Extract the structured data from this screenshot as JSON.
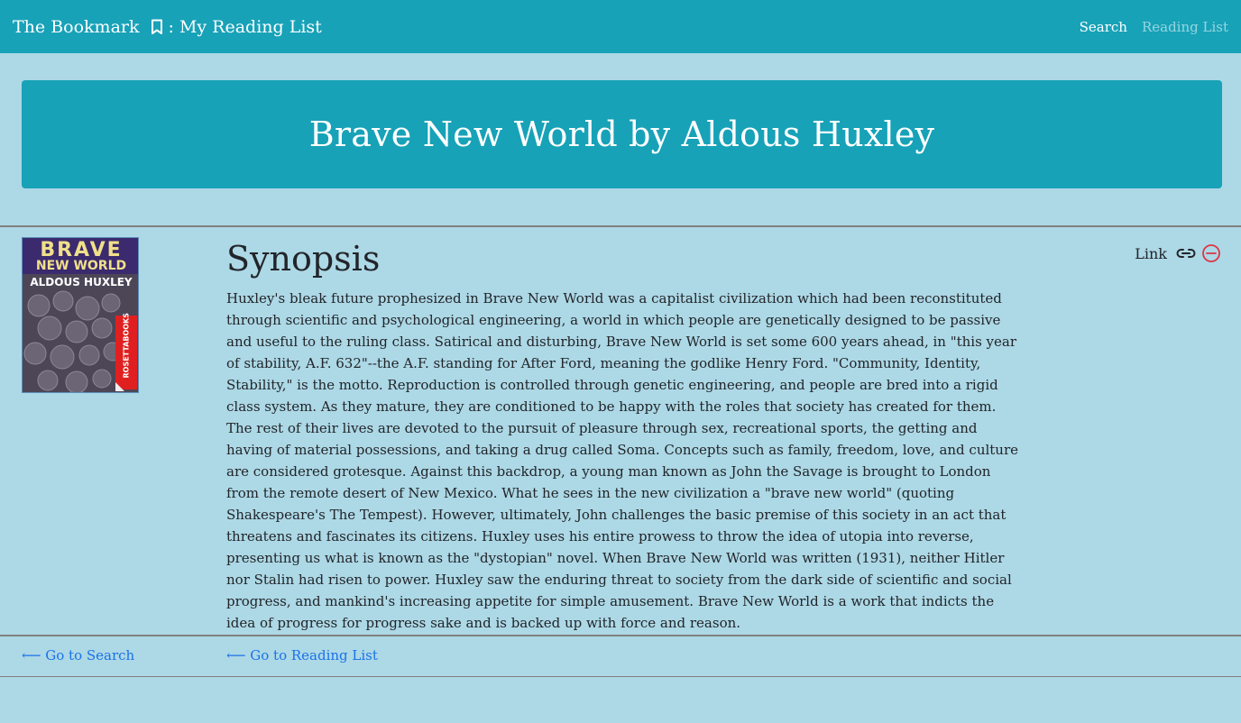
{
  "navbar": {
    "brand_prefix": "The Bookmark",
    "brand_suffix": ": My Reading List",
    "brand_icon": "bookmark-icon",
    "links": [
      {
        "label": "Search",
        "active": true
      },
      {
        "label": "Reading List",
        "active": false
      }
    ]
  },
  "header": {
    "title": "Brave New World by Aldous Huxley"
  },
  "book": {
    "cover": {
      "title_line1": "BRAVE",
      "title_line2": "NEW WORLD",
      "author": "ALDOUS HUXLEY",
      "publisher": "ROSETTABOOKS"
    },
    "synopsis_heading": "Synopsis",
    "synopsis_text": "Huxley's bleak future prophesized in Brave New World was a capitalist civilization which had been reconstituted through scientific and psychological engineering, a world in which people are genetically designed to be passive and useful to the ruling class. Satirical and disturbing, Brave New World is set some 600 years ahead, in \"this year of stability, A.F. 632\"--the A.F. standing for After Ford, meaning the godlike Henry Ford. \"Community, Identity, Stability,\" is the motto. Reproduction is controlled through genetic engineering, and people are bred into a rigid class system. As they mature, they are conditioned to be happy with the roles that society has created for them. The rest of their lives are devoted to the pursuit of pleasure through sex, recreational sports, the getting and having of material possessions, and taking a drug called Soma. Concepts such as family, freedom, love, and culture are considered grotesque. Against this backdrop, a young man known as John the Savage is brought to London from the remote desert of New Mexico. What he sees in the new civilization a \"brave new world\" (quoting Shakespeare's The Tempest). However, ultimately, John challenges the basic premise of this society in an act that threatens and fascinates its citizens. Huxley uses his entire prowess to throw the idea of utopia into reverse, presenting us what is known as the \"dystopian\" novel. When Brave New World was written (1931), neither Hitler nor Stalin had risen to power. Huxley saw the enduring threat to society from the dark side of scientific and social progress, and mankind's increasing appetite for simple amusement. Brave New World is a work that indicts the idea of progress for progress sake and is backed up with force and reason."
  },
  "actions": {
    "link_label": "Link",
    "link_icon": "chain-link-icon",
    "remove_icon": "minus-circle-icon",
    "remove_color": "#dc3545"
  },
  "footer": {
    "go_search": "⟵ Go to Search",
    "go_reading_list": "⟵ Go to Reading List"
  },
  "colors": {
    "background": "#add8e6",
    "primary": "#17a2b8",
    "link": "#1a73e8"
  }
}
